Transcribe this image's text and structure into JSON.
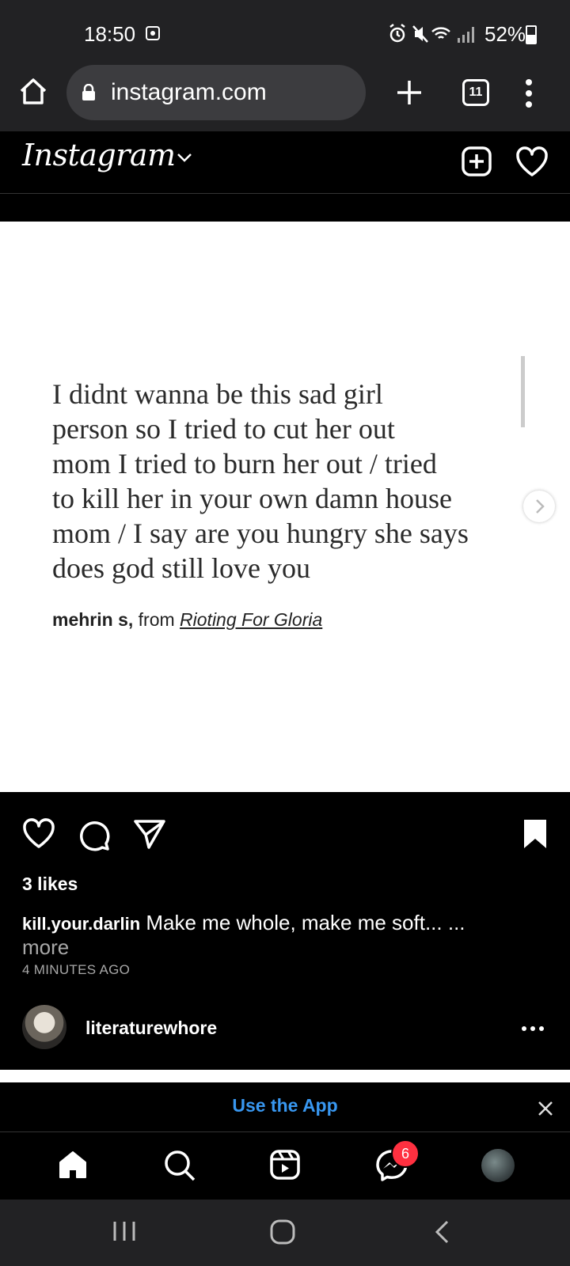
{
  "status_bar": {
    "time": "18:50",
    "battery": "52%"
  },
  "browser": {
    "url": "instagram.com",
    "tab_count": "11"
  },
  "instagram": {
    "logo": "Instagram"
  },
  "post": {
    "quote_lines": "I didnt wanna be this sad girl\nperson so I tried to cut her out\nmom I tried to burn her out / tried\nto kill her in your own damn house\nmom / I say are you hungry she says\ndoes god still love you",
    "attribution_author": "mehrin s,",
    "attribution_from": " from ",
    "attribution_source": "Rioting For Gloria",
    "likes": "3 likes",
    "caption_user": "kill.your.darlin",
    "caption_text": " Make me whole, make me soft... ...",
    "more": "more",
    "timestamp": "4 MINUTES AGO"
  },
  "next_post": {
    "username": "literaturewhore"
  },
  "banner": {
    "use_app": "Use the App"
  },
  "bottom_nav": {
    "messages_badge": "6"
  },
  "colors": {
    "link_blue": "#3897f0",
    "badge_red": "#ff3040",
    "chrome_bg": "#222224"
  }
}
